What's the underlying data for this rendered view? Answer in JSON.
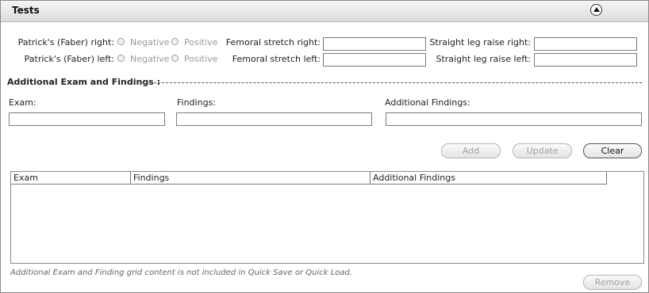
{
  "section": {
    "title": "Tests"
  },
  "patrick": {
    "right_label": "Patrick's (Faber) right:",
    "left_label": "Patrick's (Faber) left:",
    "option_negative": "Negative",
    "option_positive": "Positive"
  },
  "femoral": {
    "right_label": "Femoral stretch right:",
    "left_label": "Femoral stretch left:",
    "right_value": "",
    "left_value": ""
  },
  "slr": {
    "right_label": "Straight leg raise right:",
    "left_label": "Straight leg raise left:",
    "right_value": "",
    "left_value": ""
  },
  "additional": {
    "heading": "Additional Exam and Findings :",
    "exam_label": "Exam:",
    "findings_label": "Findings:",
    "additional_label": "Additional Findings:",
    "exam_value": "",
    "findings_value": "",
    "additional_value": ""
  },
  "buttons": {
    "add": "Add",
    "update": "Update",
    "clear": "Clear",
    "remove": "Remove"
  },
  "grid": {
    "columns": [
      "Exam",
      "Findings",
      "Additional Findings"
    ],
    "rows": []
  },
  "note": "Additional Exam and Finding grid content is not included in Quick Save or Quick Load."
}
